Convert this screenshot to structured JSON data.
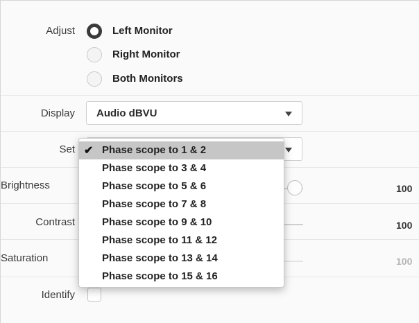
{
  "adjust": {
    "label": "Adjust",
    "options": [
      "Left Monitor",
      "Right Monitor",
      "Both Monitors"
    ],
    "selected": "Left Monitor"
  },
  "display": {
    "label": "Display",
    "value": "Audio dBVU"
  },
  "set": {
    "label": "Set",
    "options": [
      "Phase scope to 1 & 2",
      "Phase scope to 3 & 4",
      "Phase scope to 5 & 6",
      "Phase scope to 7 & 8",
      "Phase scope to 9 & 10",
      "Phase scope to 11 & 12",
      "Phase scope to 13 & 14",
      "Phase scope to 15 & 16"
    ],
    "selected": "Phase scope to 1 & 2",
    "check_mark": "✔"
  },
  "brightness": {
    "label": "Brightness",
    "value": "100"
  },
  "contrast": {
    "label": "Contrast",
    "value": "100"
  },
  "saturation": {
    "label": "Saturation",
    "value": "100"
  },
  "identify": {
    "label": "Identify",
    "checked": false
  },
  "colors": {
    "accent": "#3a3a3a",
    "selected_item_bg": "#c6c6c6",
    "disabled_text": "#b5b5b5"
  }
}
